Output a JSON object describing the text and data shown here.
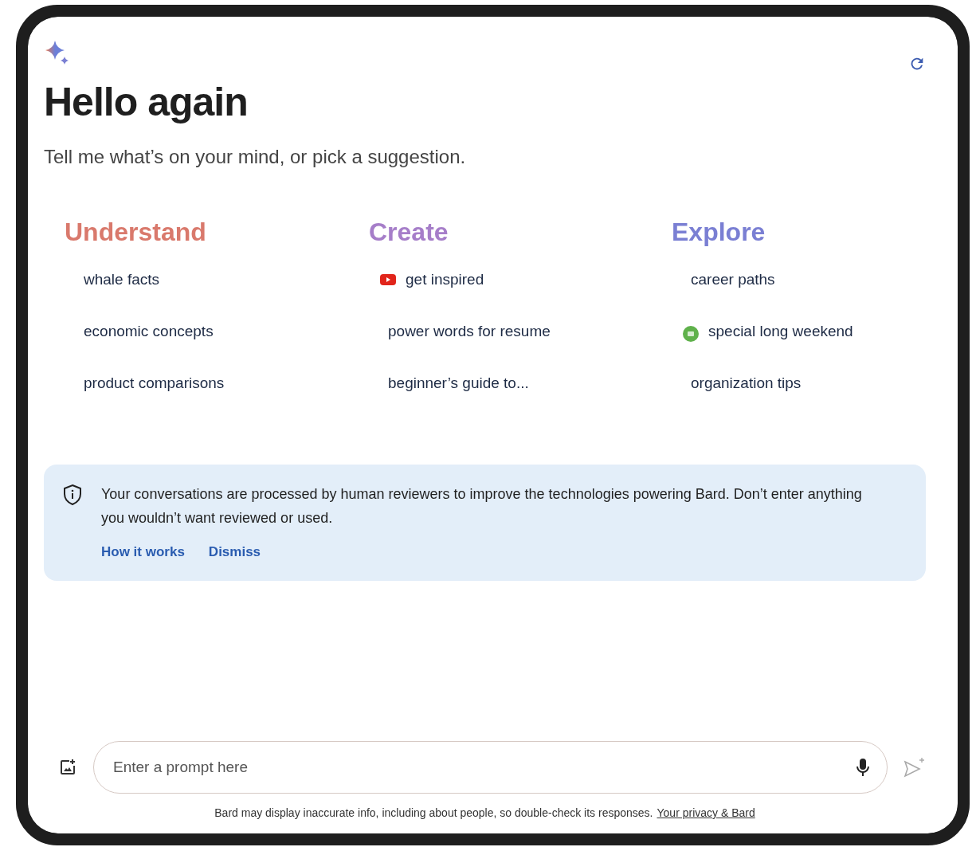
{
  "heading": "Hello again",
  "subtitle": "Tell me what’s on your mind, or pick a suggestion.",
  "categories": [
    {
      "title": "Understand",
      "color": "#d9796c",
      "items": [
        {
          "label": "whale facts",
          "kind": "plain"
        },
        {
          "label": "economic concepts",
          "kind": "plain"
        },
        {
          "label": "product comparisons",
          "kind": "plain"
        }
      ]
    },
    {
      "title": "Create",
      "color": "#a67ec9",
      "items": [
        {
          "label": "get inspired",
          "kind": "video"
        },
        {
          "label": "power words for resume",
          "kind": "plain"
        },
        {
          "label": "beginner’s guide to...",
          "kind": "plain"
        }
      ]
    },
    {
      "title": "Explore",
      "color": "#7a7fd3",
      "items": [
        {
          "label": "career paths",
          "kind": "plain"
        },
        {
          "label": "special long weekend",
          "kind": "chat"
        },
        {
          "label": "organization tips",
          "kind": "plain"
        }
      ]
    }
  ],
  "notice": {
    "text": "Your conversations are processed by human reviewers to improve the technologies powering Bard. Don’t enter anything you wouldn’t want reviewed or used.",
    "links": [
      "How it works",
      "Dismiss"
    ]
  },
  "prompt": {
    "placeholder": "Enter a prompt here"
  },
  "footer": {
    "text": "Bard may display inaccurate info, including about people, so double-check its responses.",
    "link": "Your privacy & Bard"
  }
}
